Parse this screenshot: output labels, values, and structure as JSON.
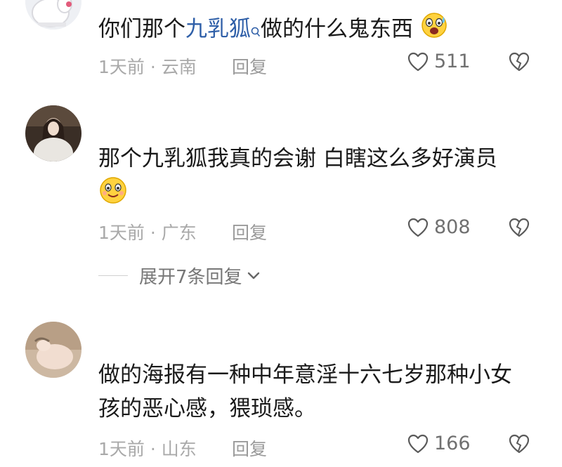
{
  "comments": [
    {
      "username": "",
      "text_pre": "你们那个",
      "link": "九乳狐",
      "text_post": "做的什么鬼东西",
      "time": "1天前 · 云南",
      "reply": "回复",
      "likes": "511",
      "emoji": "scared-emoji-icon"
    },
    {
      "username": "",
      "text": "那个九乳狐我真的会谢  白瞎这么多好演员",
      "time": "1天前 · 广东",
      "reply": "回复",
      "likes": "808",
      "emoji": "smile-emoji-icon"
    },
    {
      "username": "",
      "text": "做的海报有一种中年意淫十六七岁那种小女孩的恶心感，猥琐感。",
      "time": "1天前 · 山东",
      "reply": "回复",
      "likes": "166"
    }
  ],
  "expand_label": "展开7条回复",
  "colors": {
    "link": "#2f5fa8",
    "meta": "#a9a9a9",
    "text": "#1a1a1a"
  }
}
